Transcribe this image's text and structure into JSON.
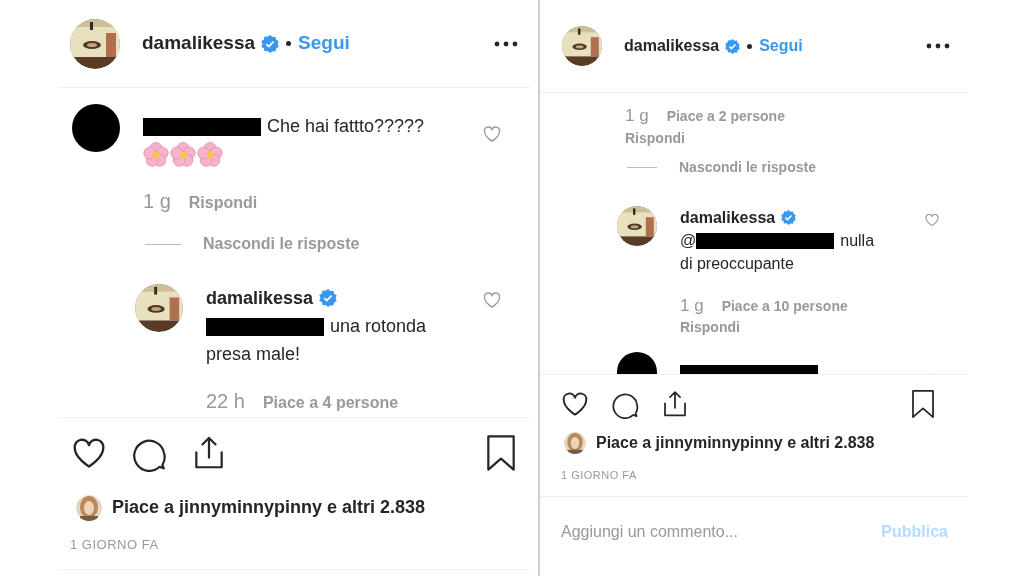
{
  "panels": [
    {
      "header": {
        "username": "damalikessa",
        "verified": true,
        "follow": "Segui"
      },
      "items": [
        {
          "kind": "comment",
          "avatar_redacted": true,
          "indent": false,
          "parts": [
            {
              "kind": "redaction"
            },
            {
              "kind": "text",
              "text": "Che hai fattto?????"
            },
            {
              "kind": "flowers"
            }
          ],
          "meta": {
            "time": "1 g",
            "reply": "Rispondi"
          }
        },
        {
          "kind": "hide_replies",
          "text": "Nascondi le risposte"
        },
        {
          "kind": "comment",
          "avatar_redacted": false,
          "indent": true,
          "username": "damalikessa",
          "verified": true,
          "parts": [
            {
              "kind": "redaction"
            },
            {
              "kind": "text",
              "text": "una rotonda presa male!"
            }
          ],
          "meta": {
            "time": "22 h",
            "likes": "Piace a 4 persone"
          }
        }
      ],
      "likes": "Piace a jinnyminnypinny e altri 2.838",
      "date": "1 GIORNO FA"
    },
    {
      "header": {
        "username": "damalikessa",
        "verified": true,
        "follow": "Segui"
      },
      "items": [
        {
          "kind": "meta",
          "meta": {
            "time": "1 g",
            "likes": "Piace a 2 persone",
            "reply": "Rispondi"
          }
        },
        {
          "kind": "hide_replies",
          "text": "Nascondi le risposte"
        },
        {
          "kind": "comment",
          "avatar_redacted": false,
          "indent": true,
          "username": "damalikessa",
          "verified": true,
          "parts": [
            {
              "kind": "text",
              "text": "@"
            },
            {
              "kind": "redaction"
            },
            {
              "kind": "text",
              "text": "nulla di preoccupante"
            }
          ],
          "meta": {
            "time": "1 g",
            "likes": "Piace a 10 persone",
            "reply": "Rispondi"
          }
        },
        {
          "kind": "comment",
          "avatar_redacted": true,
          "indent": true,
          "parts": [
            {
              "kind": "redaction"
            }
          ]
        }
      ],
      "likes": "Piace a jinnyminnypinny e altri 2.838",
      "date": "1 GIORNO FA",
      "comment_input": {
        "placeholder": "Aggiungi un commento...",
        "button": "Pubblica"
      }
    }
  ]
}
